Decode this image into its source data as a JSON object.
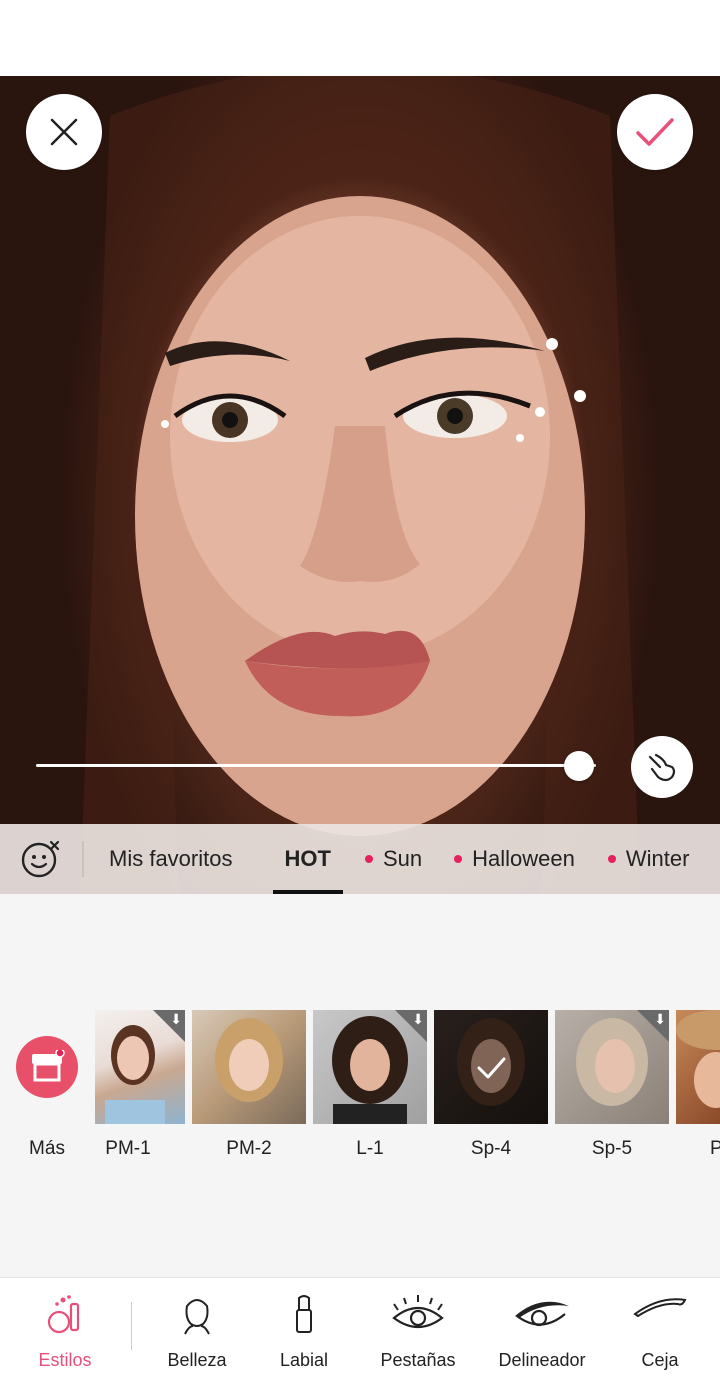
{
  "editor": {
    "close_icon": "close-icon",
    "confirm_icon": "check-icon",
    "intensity_level": 0.97,
    "compare_icon": "hand-touch-icon"
  },
  "categories": {
    "reset_icon": "face-reset-icon",
    "tabs": [
      {
        "label": "Mis favoritos",
        "dot": false,
        "active": false
      },
      {
        "label": "HOT",
        "dot": false,
        "active": true
      },
      {
        "label": "Sun",
        "dot": true,
        "active": false
      },
      {
        "label": "Halloween",
        "dot": true,
        "active": false
      },
      {
        "label": "Winter",
        "dot": true,
        "active": false
      }
    ]
  },
  "styles": {
    "more_label": "Más",
    "items": [
      {
        "label": "PM-1",
        "download": true,
        "selected": false
      },
      {
        "label": "PM-2",
        "download": false,
        "selected": false
      },
      {
        "label": "L-1",
        "download": true,
        "selected": false
      },
      {
        "label": "Sp-4",
        "download": false,
        "selected": true
      },
      {
        "label": "Sp-5",
        "download": true,
        "selected": false
      },
      {
        "label": "P",
        "download": false,
        "selected": false
      }
    ]
  },
  "bottom_nav": [
    {
      "label": "Estilos",
      "icon": "makeup-kit-icon",
      "active": true
    },
    {
      "label": "Belleza",
      "icon": "face-outline-icon",
      "active": false
    },
    {
      "label": "Labial",
      "icon": "lipstick-icon",
      "active": false
    },
    {
      "label": "Pestañas",
      "icon": "eyelash-icon",
      "active": false
    },
    {
      "label": "Delineador",
      "icon": "eyeliner-icon",
      "active": false
    },
    {
      "label": "Ceja",
      "icon": "eyebrow-icon",
      "active": false
    }
  ],
  "colors": {
    "accent": "#e8507a",
    "dot": "#e8205a",
    "store_button": "#e8506a"
  }
}
